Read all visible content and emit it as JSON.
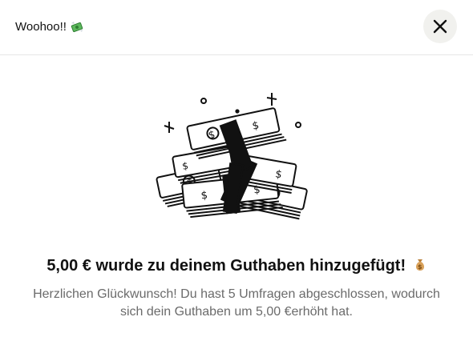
{
  "modal": {
    "title": "Woohoo!!",
    "title_icon": "money-with-wings-icon",
    "close_icon": "close-icon",
    "illustration": "stack-of-money-illustration",
    "headline": "5,00 € wurde zu deinem Guthaben hinzugefügt!",
    "headline_icon": "money-bag-icon",
    "body_line1": "Herzlichen Glückwunsch! Du hast 5 Umfragen abgeschlossen, wodurch",
    "body_line2": "sich dein Guthaben um 5,00 €erhöht hat."
  },
  "colors": {
    "close_button_bg": "#f1f1ee",
    "body_text": "#6b6b6b",
    "money_green": "#4caf50"
  }
}
